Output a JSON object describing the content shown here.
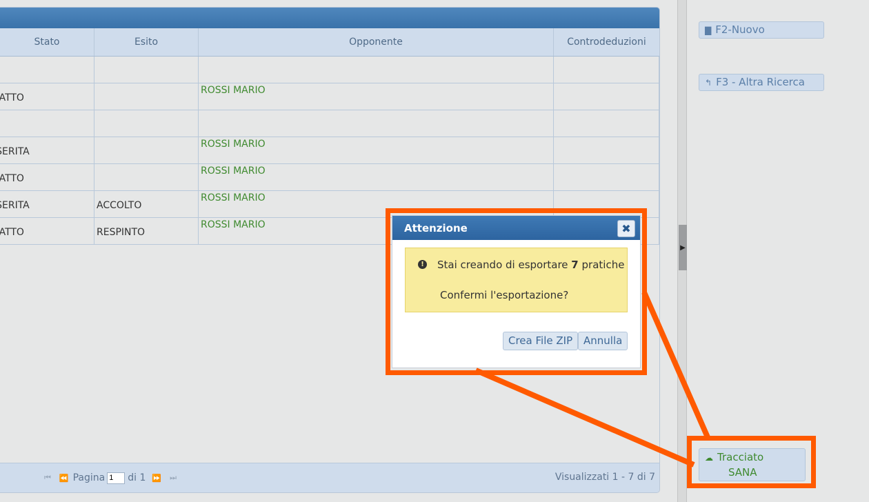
{
  "grid": {
    "columns": [
      "Stato",
      "Esito",
      "Opponente",
      "Controdeduzioni"
    ],
    "rows": [
      {
        "stato": "",
        "esito": "",
        "opponente": "",
        "controdeduzioni": ""
      },
      {
        "stato": "I ATTO",
        "esito": "",
        "opponente": "ROSSI MARIO",
        "controdeduzioni": ""
      },
      {
        "stato": "",
        "esito": "",
        "opponente": "",
        "controdeduzioni": ""
      },
      {
        "stato": "ISERITA",
        "esito": "",
        "opponente": "ROSSI MARIO",
        "controdeduzioni": ""
      },
      {
        "stato": "I ATTO",
        "esito": "",
        "opponente": "ROSSI MARIO",
        "controdeduzioni": ""
      },
      {
        "stato": "ISERITA",
        "esito": "ACCOLTO",
        "opponente": "ROSSI MARIO",
        "controdeduzioni": ""
      },
      {
        "stato": "I ATTO",
        "esito": "RESPINTO",
        "opponente": "ROSSI MARIO",
        "controdeduzioni": ""
      }
    ],
    "pager": {
      "page_label": "Pagina",
      "page_value": "1",
      "of_label": "di 1"
    },
    "records_label": "Visualizzati 1 - 7 di 7"
  },
  "side": {
    "new_button": "F2-Nuovo",
    "search_button": "F3 - Altra Ricerca",
    "tracciato_line1": "Tracciato",
    "tracciato_line2": "SANA"
  },
  "dialog": {
    "title": "Attenzione",
    "close_symbol": "✖",
    "message_prefix": "Stai creando di esportare",
    "message_count": "7",
    "message_suffix": "pratiche",
    "question": "Confermi l'esportazione?",
    "zip_button": "Crea File ZIP",
    "cancel_button": "Annulla"
  },
  "icons": {
    "info": "exclamation-circle-icon",
    "new": "document-icon",
    "back": "reply-arrow-icon",
    "upload": "cloud-upload-icon"
  },
  "colors": {
    "highlight": "#ff5a00",
    "header_blue": "#3a73aa",
    "link_green": "#3f8a2f",
    "warning_bg": "#f8ec9e"
  }
}
